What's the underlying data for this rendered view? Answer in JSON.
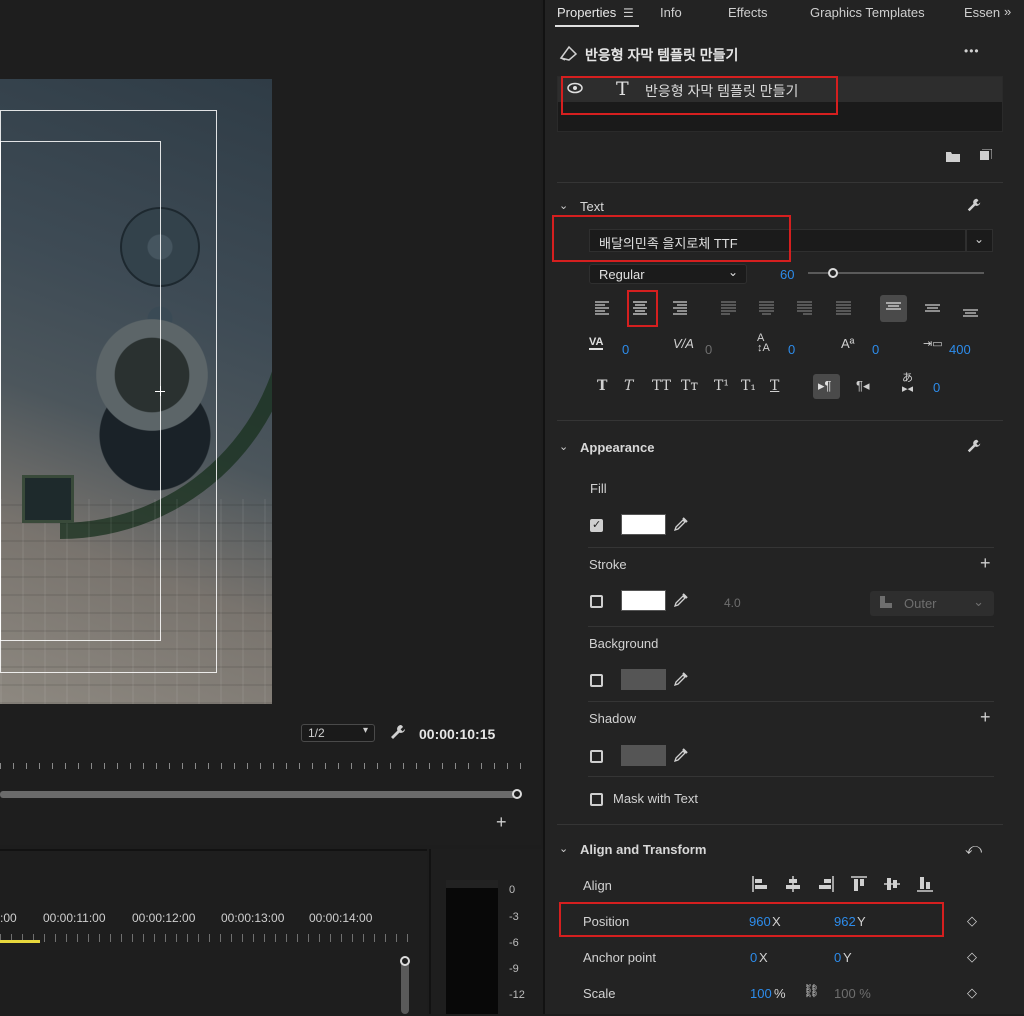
{
  "monitor": {
    "zoom": "1/2",
    "timecode": "00:00:10:15",
    "add_label": "+"
  },
  "timeline": {
    "timecodes": [
      ":00",
      "00:00:11:00",
      "00:00:12:00",
      "00:00:13:00",
      "00:00:14:00"
    ]
  },
  "meter": {
    "db_labels": [
      "0",
      "-3",
      "-6",
      "-9",
      "-12"
    ]
  },
  "tabs": [
    "Properties",
    "Info",
    "Effects",
    "Graphics Templates",
    "Essent"
  ],
  "panel": {
    "title": "반응형 자막 템플릿 만들기",
    "more": "•••",
    "layer_name": "반응형 자막 템플릿 만들기",
    "text": {
      "header": "Text",
      "font": "배달의민족 을지로체 TTF",
      "style": "Regular",
      "size": "60",
      "tracking": {
        "kerning": "0",
        "tracking_auto": "0",
        "leading": "0",
        "baseline": "0",
        "tab": "400"
      },
      "tsume": "0",
      "format_glyphs": [
        "T",
        "T",
        "TT",
        "Tт",
        "T¹",
        "T₁",
        "T"
      ]
    },
    "appearance": {
      "header": "Appearance",
      "fill_label": "Fill",
      "stroke_label": "Stroke",
      "stroke_width": "4.0",
      "stroke_type": "Outer",
      "background_label": "Background",
      "shadow_label": "Shadow",
      "mask_label": "Mask with Text",
      "fill_color": "#ffffff",
      "stroke_color": "#ffffff",
      "bg_color": "#555555",
      "shadow_color": "#555555"
    },
    "transform": {
      "header": "Align and Transform",
      "align_label": "Align",
      "position_label": "Position",
      "position_x": "960",
      "position_y": "962",
      "anchor_label": "Anchor point",
      "anchor_x": "0",
      "anchor_y": "0",
      "scale_label": "Scale",
      "scale_x": "100",
      "scale_y": "100 %",
      "x_unit": "X",
      "y_unit": "Y",
      "pct": "%"
    }
  },
  "colors": {
    "accent": "#2d8ceb",
    "highlight": "#d51f1f"
  }
}
